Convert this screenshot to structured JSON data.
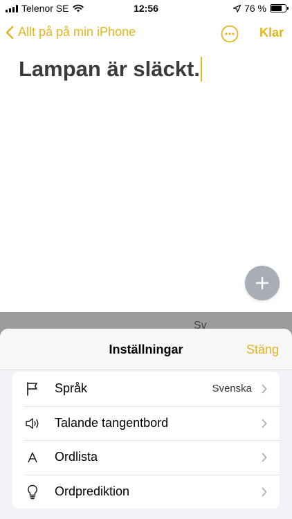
{
  "status_bar": {
    "carrier": "Telenor SE",
    "time": "12:56",
    "battery_text": "76 %",
    "battery_level": 0.76
  },
  "nav": {
    "back_label": "Allt på på min iPhone",
    "done_label": "Klar"
  },
  "note": {
    "title": "Lampan är släckt."
  },
  "keyboard_peek": [
    "Sv"
  ],
  "sheet": {
    "title": "Inställningar",
    "close_label": "Stäng",
    "items": [
      {
        "icon": "flag-icon",
        "label": "Språk",
        "value": "Svenska"
      },
      {
        "icon": "speaker-icon",
        "label": "Talande tangentbord",
        "value": ""
      },
      {
        "icon": "letter-a-icon",
        "label": "Ordlista",
        "value": ""
      },
      {
        "icon": "lightbulb-icon",
        "label": "Ordprediktion",
        "value": ""
      }
    ]
  },
  "colors": {
    "accent": "#e0b51f",
    "sheet_bg": "#f2f2f7",
    "fab_bg": "#a9adb5"
  }
}
